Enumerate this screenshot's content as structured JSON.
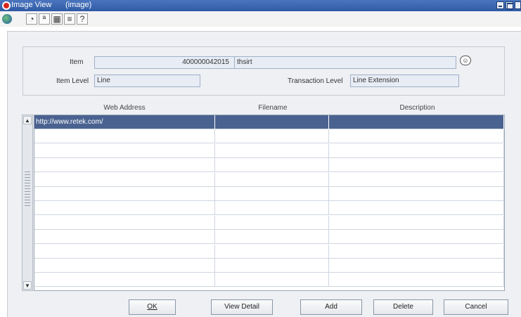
{
  "window": {
    "title": "Image View",
    "subtitle": "(image)"
  },
  "toolbar": {
    "icons": [
      "globe-icon",
      "help-context-icon",
      "spell-check-icon",
      "calendar-icon",
      "notes-icon",
      "help-icon"
    ]
  },
  "header": {
    "item_label": "Item",
    "item_number": "400000042015",
    "item_desc": "thsirt",
    "item_level_label": "Item Level",
    "item_level_value": "Line",
    "transaction_level_label": "Transaction Level",
    "transaction_level_value": "Line Extension"
  },
  "table": {
    "columns": [
      "Web Address",
      "Filename",
      "Description"
    ],
    "rows": [
      [
        "http://www.retek.com/",
        "",
        ""
      ],
      [
        "",
        "",
        ""
      ],
      [
        "",
        "",
        ""
      ],
      [
        "",
        "",
        ""
      ],
      [
        "",
        "",
        ""
      ],
      [
        "",
        "",
        ""
      ],
      [
        "",
        "",
        ""
      ],
      [
        "",
        "",
        ""
      ],
      [
        "",
        "",
        ""
      ],
      [
        "",
        "",
        ""
      ],
      [
        "",
        "",
        ""
      ],
      [
        "",
        "",
        ""
      ]
    ],
    "selected_row": 0
  },
  "buttons": {
    "ok": "OK",
    "view_detail": "View Detail",
    "add": "Add",
    "delete": "Delete",
    "cancel": "Cancel"
  },
  "colors": {
    "title_bar": "#2f5aa4",
    "selected_row": "#4a6290",
    "panel_bg": "#eef0f3"
  }
}
